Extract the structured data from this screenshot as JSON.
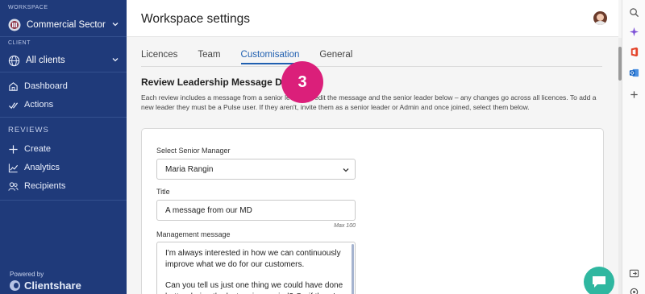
{
  "sidebar": {
    "workspace_label": "WORKSPACE",
    "workspace_name": "Commercial Sector",
    "client_label": "CLIENT",
    "client_name": "All clients",
    "nav": [
      {
        "label": "Dashboard",
        "icon": "home-icon"
      },
      {
        "label": "Actions",
        "icon": "check-icon"
      }
    ],
    "reviews_heading": "REVIEWS",
    "reviews": [
      {
        "label": "Create",
        "icon": "plus-icon"
      },
      {
        "label": "Analytics",
        "icon": "analytics-icon"
      },
      {
        "label": "Recipients",
        "icon": "users-icon"
      }
    ],
    "powered_by": "Powered by",
    "brand": "Clientshare"
  },
  "header": {
    "title": "Workspace settings"
  },
  "tabs": [
    {
      "label": "Licences",
      "active": false
    },
    {
      "label": "Team",
      "active": false
    },
    {
      "label": "Customisation",
      "active": true
    },
    {
      "label": "General",
      "active": false
    }
  ],
  "section": {
    "title": "Review Leadership Message Deta",
    "description": "Each review includes a message from a senior le     ou can edit the message and the senior leader below – any changes go across all licences. To add a new leader they must be a Pulse user. If they aren't, invite them as a senior leader or Admin and once joined, select them below."
  },
  "form": {
    "manager_label": "Select Senior Manager",
    "manager_value": "Maria Rangin",
    "title_label": "Title",
    "title_value": "A message from our MD",
    "title_max": "Max 100",
    "message_label": "Management message",
    "message_paragraphs": [
      "I'm always interested in how we can continuously improve what we do for our customers.",
      "Can you tell us just one thing we could have done better during the last review period? Or, if there's"
    ]
  },
  "step_badge": "3",
  "colors": {
    "sidebar": "#1f3a7a",
    "accent": "#1f5fb0",
    "badge": "#db1f7a",
    "chat": "#2fb7a0"
  }
}
